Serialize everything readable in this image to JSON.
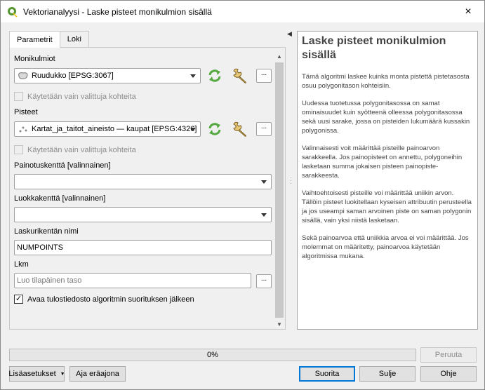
{
  "window": {
    "title": "Vektorianalyysi - Laske pisteet monikulmion sisällä",
    "close_icon": "×"
  },
  "tabs": [
    {
      "label": "Parametrit",
      "active": true
    },
    {
      "label": "Loki",
      "active": false
    }
  ],
  "params": {
    "polygons": {
      "label": "Monikulmiot",
      "value": "Ruudukko [EPSG:3067]",
      "selected_only": "Käytetään vain valittuja kohteita",
      "selected_checked": false
    },
    "points": {
      "label": "Pisteet",
      "value": "Kartat_ja_taitot_aineisto — kaupat [EPSG:4326]",
      "selected_only": "Käytetään vain valittuja kohteita",
      "selected_checked": false
    },
    "weight": {
      "label": "Painotuskenttä [valinnainen]",
      "value": ""
    },
    "class": {
      "label": "Luokkakenttä [valinnainen]",
      "value": ""
    },
    "field_name": {
      "label": "Laskurikentän nimi",
      "value": "NUMPOINTS"
    },
    "count": {
      "label": "Lkm",
      "placeholder": "Luo tilapäinen taso",
      "open_after": "Avaa tulostiedosto algoritmin suorituksen jälkeen",
      "open_after_checked": true
    },
    "ellipsis": "..."
  },
  "help": {
    "title": "Laske pisteet monikulmion sisällä",
    "paragraphs": [
      "Tämä algoritmi laskee kuinka monta pistettä pistetasosta osuu polygonitason kohteisiin.",
      "Uudessa tuotetussa polygonitasossa on samat ominaisuudet kuin syötteenä olleessa polygonitasossa sekä uusi sarake, jossa on pisteiden lukumäärä kussakin polygonissa.",
      "Valinnaisesti voit määrittää pisteille painoarvon sarakkeella. Jos painopisteet on annettu, polygoneihin lasketaan summa jokaisen pisteen painopiste-sarakkeesta.",
      "Vaihtoehtoisesti pisteille voi määrittää uniikin arvon. Tällöin pisteet luokitellaan kyseisen attribuutin perusteella ja jos useampi saman arvoinen piste on saman polygonin sisällä, vain yksi niistä lasketaan.",
      "Sekä painoarvoa että uniikkia arvoa ei voi määrittää. Jos molemmat on määritetty, painoarvoa käytetään algoritmissa mukana."
    ]
  },
  "progress": {
    "text": "0%",
    "value": 0
  },
  "buttons": {
    "cancel": "Peruuta",
    "advanced": "Lisäasetukset",
    "batch": "Aja eräajona",
    "run": "Suorita",
    "close": "Sulje",
    "help": "Ohje"
  },
  "colors": {
    "accent": "#0078d7",
    "refresh_green": "#53a93f",
    "qgis_green": "#589632"
  }
}
